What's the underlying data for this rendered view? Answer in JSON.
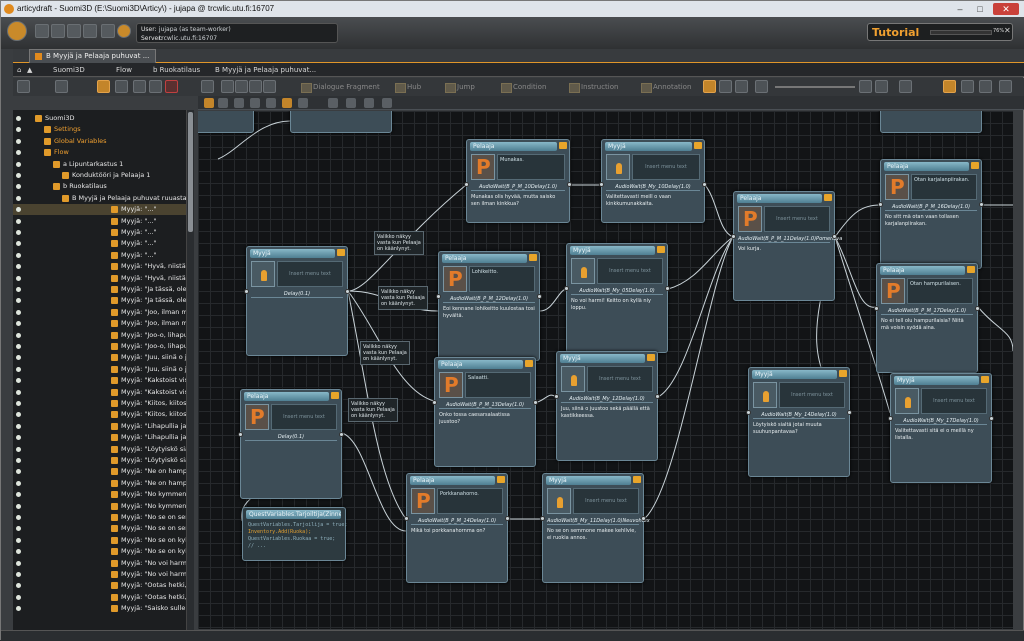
{
  "window": {
    "title": "articydraft - Suomi3D (E:\\Suomi3D\\Articy\\) - jujapa @ trcwlic.utu.fi:16707"
  },
  "user": {
    "user_label": "User:",
    "user_value": "jujapa (as team-worker)",
    "server_label": "Server:",
    "server_value": "trcwlic.utu.fi:16707"
  },
  "tutorial": {
    "label": "Tutorial",
    "progress_percent": 76,
    "progress_text": "76%",
    "close": "✕"
  },
  "tab": {
    "label": "B Myyjä ja Pelaaja puhuvat ..."
  },
  "breadcrumb": [
    "Suomi3D",
    "Flow",
    "b Ruokatilaus",
    "B Myyjä ja Pelaaja puhuvat..."
  ],
  "toolbar": {
    "dialogue_fragment": "Dialogue Fragment",
    "hub": "Hub",
    "jump": "Jump",
    "condition": "Condition",
    "instruction": "Instruction",
    "annotation": "Annotation"
  },
  "navigator": [
    {
      "label": "Suomi3D",
      "indent": 0,
      "color": "white"
    },
    {
      "label": "Settings",
      "indent": 1,
      "color": "orange"
    },
    {
      "label": "Global Variables",
      "indent": 1,
      "color": "orange"
    },
    {
      "label": "Flow",
      "indent": 1,
      "color": "orange"
    },
    {
      "label": "a Lipuntarkastus 1",
      "indent": 2,
      "color": "white"
    },
    {
      "label": "Konduktööri ja Pelaaja 1",
      "indent": 3,
      "color": "white"
    },
    {
      "label": "b Ruokatilaus",
      "indent": 2,
      "color": "white"
    },
    {
      "label": "B Myyjä ja Pelaaja puhuvat ruuasta.",
      "indent": 3,
      "color": "white"
    },
    {
      "label": "Myyjä: \"...\"",
      "indent": 4,
      "color": "white",
      "selected": true
    },
    {
      "label": "Myyjä: \"...\"",
      "indent": 4,
      "color": "white"
    },
    {
      "label": "Myyjä: \"...\"",
      "indent": 4,
      "color": "white"
    },
    {
      "label": "Myyjä: \"...\"",
      "indent": 4,
      "color": "white"
    },
    {
      "label": "Myyjä: \"...\"",
      "indent": 4,
      "color": "white"
    },
    {
      "label": "Myyjä: \"Hyvä, niistä onki aina vähä pul",
      "indent": 4,
      "color": "white"
    },
    {
      "label": "Myyjä: \"Hyvä, niistä onki aina vähä pul",
      "indent": 4,
      "color": "white"
    },
    {
      "label": "Myyjä: \"Ja tässä, ole hyvä! Täs ois sull",
      "indent": 4,
      "color": "white"
    },
    {
      "label": "Myyjä: \"Ja tässä, ole hyvä! Täs ois sull",
      "indent": 4,
      "color": "white"
    },
    {
      "label": "Myyjä: \"Joo, ilman muusta. Maksupääte",
      "indent": 4,
      "color": "white"
    },
    {
      "label": "Myyjä: \"Joo, ilman muusta. Maksupääte",
      "indent": 4,
      "color": "white"
    },
    {
      "label": "Myyjä: \"Joo-o, lihapullia ja muusia. Se",
      "indent": 4,
      "color": "white"
    },
    {
      "label": "Myyjä: \"Joo-o, lihapullia ja muusia. Se",
      "indent": 4,
      "color": "white"
    },
    {
      "label": "Myyjä: \"Juu, siinä o juustoo sekä päälli",
      "indent": 4,
      "color": "white"
    },
    {
      "label": "Myyjä: \"Juu, siinä o juustoo sekä päälli",
      "indent": 4,
      "color": "white"
    },
    {
      "label": "Myyjä: \"Kakstoist viskyt.\"",
      "indent": 4,
      "color": "white"
    },
    {
      "label": "Myyjä: \"Kakstoist viskyt.\"",
      "indent": 4,
      "color": "white"
    },
    {
      "label": "Myyjä: \"Kiitos, kiitos!\"",
      "indent": 4,
      "color": "white"
    },
    {
      "label": "Myyjä: \"Kiitos, kiitos!\"",
      "indent": 4,
      "color": "white"
    },
    {
      "label": "Myyjä: \"Lihapullia ja muusia.\"",
      "indent": 4,
      "color": "white"
    },
    {
      "label": "Myyjä: \"Lihapullia ja muusia.\"",
      "indent": 4,
      "color": "white"
    },
    {
      "label": "Myyjä: \"Löytyiskö sialtä jotai muuta su",
      "indent": 4,
      "color": "white"
    },
    {
      "label": "Myyjä: \"Löytyiskö sialtä jotai muuta su",
      "indent": 4,
      "color": "white"
    },
    {
      "label": "Myyjä: \"Ne on hampurilaiskioskin alen",
      "indent": 4,
      "color": "white"
    },
    {
      "label": "Myyjä: \"Ne on hampurilaiskioskin alen",
      "indent": 4,
      "color": "white"
    },
    {
      "label": "Myyjä: \"No kymmenkunta.\"",
      "indent": 4,
      "color": "white"
    },
    {
      "label": "Myyjä: \"No kymmenkunta.\"",
      "indent": 4,
      "color": "white"
    },
    {
      "label": "Myyjä: \"No se on semmone makee ka",
      "indent": 4,
      "color": "white"
    },
    {
      "label": "Myyjä: \"No se on semmone makee ka",
      "indent": 4,
      "color": "white"
    },
    {
      "label": "Myyjä: \"No se on kyllä reilun kokone.\"",
      "indent": 4,
      "color": "white"
    },
    {
      "label": "Myyjä: \"No se on kyllä reilun kokone.\"",
      "indent": 4,
      "color": "white"
    },
    {
      "label": "Myyjä: \"No voi harmi! Keitto on kyllä r",
      "indent": 4,
      "color": "white"
    },
    {
      "label": "Myyjä: \"No voi harmi! Keitto on kyllä r",
      "indent": 4,
      "color": "white"
    },
    {
      "label": "Myyjä: \"Ootas hetki, ni mää lämmitän",
      "indent": 4,
      "color": "white"
    },
    {
      "label": "Myyjä: \"Ootas hetki, ni mää lämmitän",
      "indent": 4,
      "color": "white"
    },
    {
      "label": "Myyjä: \"Saisko sulle kuitenki olla jotai",
      "indent": 4,
      "color": "white"
    }
  ],
  "nodes": [
    {
      "id": "n1",
      "header": "Pelaaja",
      "pic": "p",
      "text": "Munakas.",
      "stage": "AudioWait(B_P_M_10Delay(1.0)",
      "body": "Munakas olis hyvää, mutta saisko sen ilman kinkkua?"
    },
    {
      "id": "n2",
      "header": "Myyjä",
      "pic": "m",
      "text": "Insert menu text",
      "stage": "AudioWait(B_My_10Delay(1.0)",
      "body": "Valitettavasti meill o vaan kinkkumunakkaita."
    },
    {
      "id": "n3",
      "header": "Pelaaja",
      "pic": "p",
      "text": "Insert menu text",
      "stage": "AudioWait(B_P_M_11Delay(1.0)Pomenova",
      "body": "Voi kurja."
    },
    {
      "id": "n4",
      "header": "Pelaaja",
      "pic": "p",
      "text": "Otan karjalanpiirakan.",
      "stage": "AudioWait(B_P_M_16Delay(1.0)",
      "body": "No sitt mä otan vaan tollasen karjalanpiirakan."
    },
    {
      "id": "n5",
      "header": "Myyjä",
      "pic": "m",
      "text": "Insert menu text",
      "stage": "Delay(0.1)",
      "body": ""
    },
    {
      "id": "n6",
      "header": "Pelaaja",
      "pic": "p",
      "text": "Lohikeitto.",
      "stage": "AudioWait(B_P_M_12Delay(1.0)",
      "body": "Eoi kennane lohikeitto kuulostaa tosi hyvältä."
    },
    {
      "id": "n7",
      "header": "Myyjä",
      "pic": "m",
      "text": "Insert menu text",
      "stage": "AudioWait(B_My_05Delay(1.0)",
      "body": "No voi harmi! Keitto on kyllä niy loppu."
    },
    {
      "id": "n8",
      "header": "Pelaaja",
      "pic": "p",
      "text": "Otan hampurilaisen.",
      "stage": "AudioWait(B_P_M_17Delay(1.0)",
      "body": "No ei tell olu hampurilaisia? Niitä mä voisin syödä aina."
    },
    {
      "id": "n9",
      "header": "Pelaaja",
      "pic": "p",
      "text": "Insert menu text",
      "stage": "Delay(0.1)",
      "body": ""
    },
    {
      "id": "n10",
      "header": "Pelaaja",
      "pic": "p",
      "text": "Salaatti.",
      "stage": "AudioWait(B_P_M_13Delay(1.0)",
      "body": "Onko tossa caesarsalaatissa juustoo?"
    },
    {
      "id": "n11",
      "header": "Myyjä",
      "pic": "m",
      "text": "Insert menu text",
      "stage": "AudioWait(B_My_12Delay(1.0)",
      "body": "Juu, siinä o juustoo sekä päällä että kastikkeessa."
    },
    {
      "id": "n12",
      "header": "Myyjä",
      "pic": "m",
      "text": "Insert menu text",
      "stage": "AudioWait(B_My_14Delay(1.0)",
      "body": "Löytyiskö sialtä jotai muuta suuhunpantavaa?"
    },
    {
      "id": "n13",
      "header": "Myyjä",
      "pic": "m",
      "text": "Insert menu text",
      "stage": "AudioWait(B_My_17Delay(1.0)",
      "body": "Valitettavasti sitä ei o meillä ny listalla."
    },
    {
      "id": "n14",
      "header": "Pelaaja",
      "pic": "p",
      "text": "Porkkanahorno.",
      "stage": "AudioWait(B_P_M_14Delay(1.0)",
      "body": "Mikä toi porkkanahornma on?"
    },
    {
      "id": "n15",
      "header": "Myyjä",
      "pic": "m",
      "text": "Insert menu text",
      "stage": "AudioWait(B_My_11Delay(1.0)Neuvohtex",
      "body": "No se on semmone makee kehllvie, ei ruokia annos."
    }
  ],
  "instruction_node": {
    "header": "QuestVariables.Tarjoiltija(Zinne = true;",
    "lines": [
      "QuestVariables.Tarjoilija = true;",
      "Inventory.Add(Ruoka);",
      "QuestVariables.Ruokaa = true;",
      "// ..."
    ]
  },
  "labels": [
    "Valikko näkyy vasta kun Pelaaja on käänlynyt.",
    "Valikko näkyy vasta kun Pelaaja on käänlynyt.",
    "Valikko näkyy vasta kun Pelaaja on käänlynyt.",
    "Valikko näkyy vasta kun Pelaaja on käänlynyt."
  ],
  "colors": {
    "accent": "#e0962a",
    "node_fill": "#3d4d57",
    "node_header": "#6fa3b6",
    "canvas_bg": "#121416",
    "pelaaja_icon": "#e27b2a"
  }
}
